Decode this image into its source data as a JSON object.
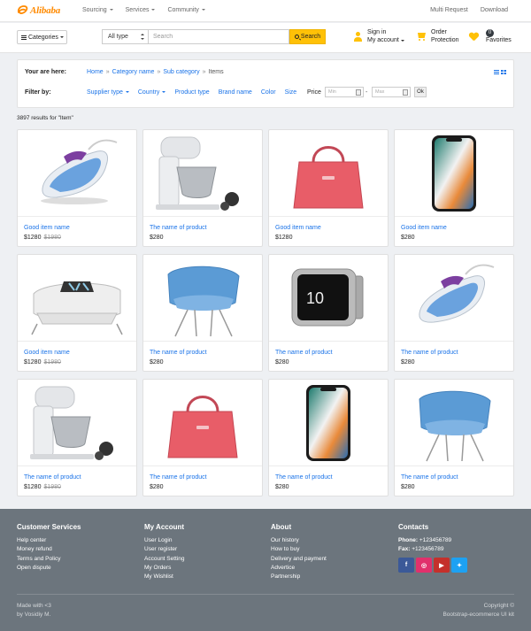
{
  "brand": {
    "name": "Alibaba",
    "color": "#ff8a00"
  },
  "topnav": {
    "items": [
      "Sourcing",
      "Services",
      "Community"
    ],
    "right": [
      "Multi Request",
      "Download"
    ]
  },
  "header": {
    "categories_label": "Categories",
    "search": {
      "type_value": "All type",
      "placeholder": "Search",
      "button_label": "Search"
    },
    "account": {
      "line1": "Sign in",
      "line2": "My account"
    },
    "order": {
      "line1": "Order",
      "line2": "Protection"
    },
    "favorites": {
      "badge": "0",
      "label": "Favorites"
    },
    "accent_color": "#ffc107"
  },
  "filters": {
    "you_are_here_label": "Your are here:",
    "breadcrumb": [
      "Home",
      "Category name",
      "Sub category",
      "Items"
    ],
    "filter_by_label": "Filter by:",
    "options": [
      "Supplier type",
      "Country",
      "Product type",
      "Brand name",
      "Color",
      "Size"
    ],
    "price_label": "Price",
    "min_placeholder": "Min",
    "max_placeholder": "Max",
    "ok_label": "Ok",
    "link_color": "#1a73e8"
  },
  "results_text": "3897 results for \"Item\"",
  "products": [
    {
      "image": "iron-icon",
      "name": "Good item name",
      "price": "$1280",
      "old_price": "$1980"
    },
    {
      "image": "mixer-icon",
      "name": "The name of product",
      "price": "$280",
      "old_price": ""
    },
    {
      "image": "handbag-icon",
      "name": "Good item name",
      "price": "$1280",
      "old_price": ""
    },
    {
      "image": "smartphone-icon",
      "name": "Good item name",
      "price": "$280",
      "old_price": ""
    },
    {
      "image": "pillow-icon",
      "name": "Good item name",
      "price": "$1280",
      "old_price": "$1980"
    },
    {
      "image": "armchair-icon",
      "name": "The name of product",
      "price": "$280",
      "old_price": ""
    },
    {
      "image": "smartwatch-icon",
      "name": "The name of product",
      "price": "$280",
      "old_price": ""
    },
    {
      "image": "iron-icon",
      "name": "The name of product",
      "price": "$280",
      "old_price": ""
    },
    {
      "image": "mixer-icon",
      "name": "The name of product",
      "price": "$1280",
      "old_price": "$1980"
    },
    {
      "image": "handbag-icon",
      "name": "The name of product",
      "price": "$280",
      "old_price": ""
    },
    {
      "image": "smartphone-icon",
      "name": "The name of product",
      "price": "$280",
      "old_price": ""
    },
    {
      "image": "armchair-icon",
      "name": "The name of product",
      "price": "$280",
      "old_price": ""
    }
  ],
  "footer": {
    "customer": {
      "title": "Customer Services",
      "links": [
        "Help center",
        "Money refund",
        "Terms and Policy",
        "Open dispute"
      ]
    },
    "account": {
      "title": "My Account",
      "links": [
        "User Login",
        "User register",
        "Account Setting",
        "My Orders",
        "My Wishlist"
      ]
    },
    "about": {
      "title": "About",
      "links": [
        "Our history",
        "How to buy",
        "Delivery and payment",
        "Advertice",
        "Partnership"
      ]
    },
    "contacts": {
      "title": "Contacts",
      "phone_label": "Phone:",
      "phone": "+123456789",
      "fax_label": "Fax:",
      "fax": "+123456789"
    },
    "social": [
      {
        "icon": "facebook-icon",
        "glyph": "f",
        "color": "#3b5998"
      },
      {
        "icon": "instagram-icon",
        "glyph": "◎",
        "color": "#e1306c"
      },
      {
        "icon": "youtube-icon",
        "glyph": "▶",
        "color": "#c4302b"
      },
      {
        "icon": "twitter-icon",
        "glyph": "✦",
        "color": "#1da1f2"
      }
    ],
    "made_with": "Made with <3",
    "by": "by Vosidiy M.",
    "copyright": "Copyright ©",
    "kit": "Bootstrap-ecommerce UI kit",
    "bg_color": "#6c757d"
  }
}
